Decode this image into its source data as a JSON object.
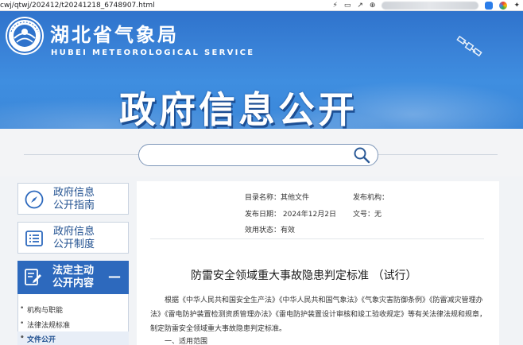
{
  "browser": {
    "url": "cwj/qtwj/202412/t20241218_6748907.html",
    "icons": [
      "bolt-icon",
      "share-icon",
      "forward-icon",
      "translate-icon"
    ]
  },
  "header": {
    "org_cn": "湖北省气象局",
    "org_en": "HUBEI METEOROLOGICAL SERVICE",
    "banner_title": "政府信息公开",
    "colors": {
      "banner": "#3a83d8",
      "accent": "#2d69bd"
    }
  },
  "search": {
    "placeholder": ""
  },
  "sidebar": {
    "items": [
      {
        "label_line1": "政府信息",
        "label_line2": "公开指南",
        "icon": "compass-icon"
      },
      {
        "label_line1": "政府信息",
        "label_line2": "公开制度",
        "icon": "list-icon"
      },
      {
        "label_line1": "法定主动",
        "label_line2": "公开内容",
        "icon": "edit-icon",
        "toggle": "—"
      }
    ],
    "subitems": [
      {
        "label": "机构与职能"
      },
      {
        "label": "法律法规标准"
      },
      {
        "label": "文件公开"
      }
    ]
  },
  "doc": {
    "catalog_label": "目录名称：其他文件",
    "publisher_label": "发布机构：",
    "date_label": "发布日期：  2024年12月2日",
    "docno_label": "文号：无",
    "status_label": "效用状态：有效",
    "title": "防雷安全领域重大事故隐患判定标准  （试行）",
    "paragraph": "根据《中华人民共和国安全生产法》《中华人民共和国气象法》《气象灾害防御条例》《防雷减灾管理办法》《雷电防护装置检测资质管理办法》《雷电防护装置设计审核和竣工验收规定》等有关法律法规和规章，制定防雷安全领域重大事故隐患判定标准。",
    "section1": "一、适用范围"
  }
}
